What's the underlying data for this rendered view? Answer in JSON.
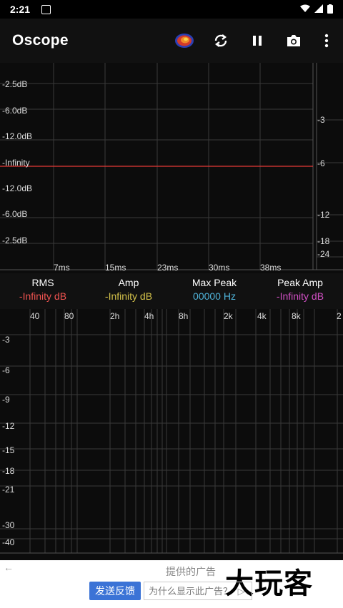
{
  "status": {
    "time": "2:21"
  },
  "app": {
    "title": "Oscope"
  },
  "scope": {
    "y_labels_left": [
      "-2.5dB",
      "-6.0dB",
      "-12.0dB",
      "-Infinity",
      "-12.0dB",
      "-6.0dB",
      "-2.5dB"
    ],
    "y_labels_right": [
      "-3",
      "-6",
      "-12",
      "-18",
      "-24"
    ],
    "x_labels": [
      "7ms",
      "15ms",
      "23ms",
      "30ms",
      "38ms"
    ],
    "trace_color": "#e53935"
  },
  "readout": {
    "rms_label": "RMS",
    "rms_value": "-Infinity dB",
    "rms_color": "#ef5350",
    "amp_label": "Amp",
    "amp_value": "-Infinity dB",
    "amp_color": "#d4c24a",
    "maxpeak_label": "Max Peak",
    "maxpeak_value": "00000 Hz",
    "maxpeak_color": "#4fb3d9",
    "peakamp_label": "Peak Amp",
    "peakamp_value": "-Infinity dB",
    "peakamp_color": "#d04fc3"
  },
  "spectrum": {
    "x_labels": [
      "40",
      "80",
      "2h",
      "4h",
      "8h",
      "2k",
      "4k",
      "8k",
      "2"
    ],
    "y_labels": [
      "-3",
      "-6",
      "-9",
      "-12",
      "-15",
      "-18",
      "-21",
      "-30",
      "-40"
    ]
  },
  "ad": {
    "back": "←",
    "provided_by": "提供的广告",
    "brand": "大玩客",
    "feedback_button": "发送反馈",
    "why_text": "为什么显示此广告？",
    "why_icon": "▷"
  }
}
